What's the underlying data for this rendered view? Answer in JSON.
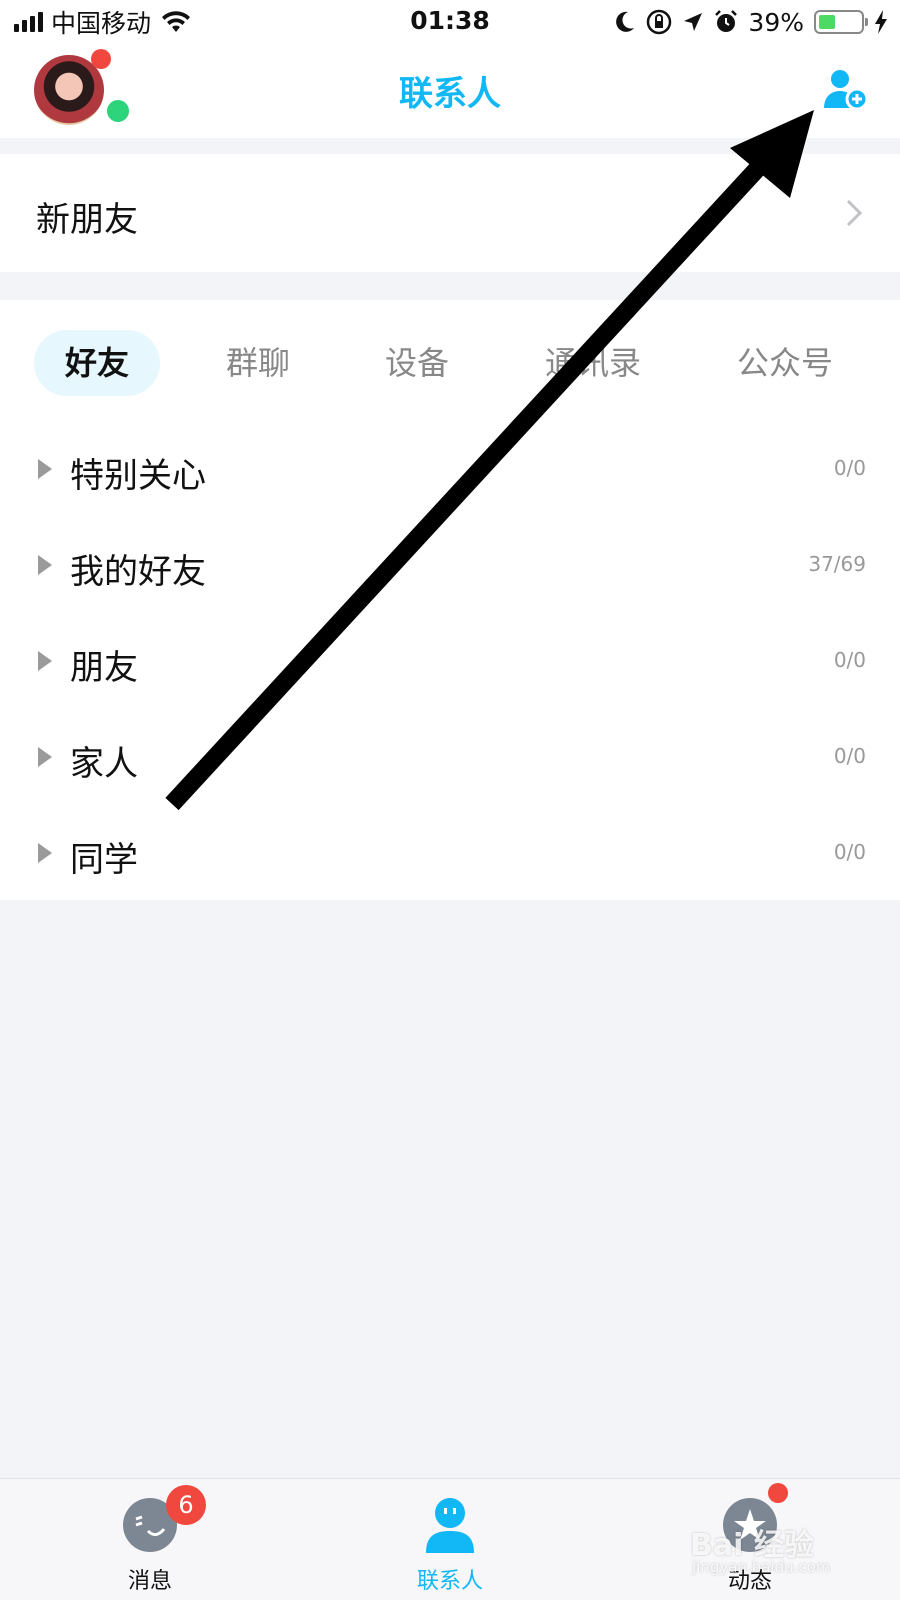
{
  "status_bar": {
    "carrier": "中国移动",
    "time": "01:38",
    "battery_percent": "39%",
    "battery_level": 0.39,
    "icons": [
      "signal-icon",
      "wifi-icon",
      "moon-icon",
      "orientation-lock-icon",
      "location-icon",
      "alarm-icon",
      "battery-icon",
      "charging-icon"
    ]
  },
  "header": {
    "title": "联系人",
    "avatar_icon": "user-avatar",
    "add_icon": "add-friend-icon"
  },
  "new_friends": {
    "label": "新朋友"
  },
  "tabs": [
    {
      "label": "好友",
      "active": true
    },
    {
      "label": "群聊",
      "active": false
    },
    {
      "label": "设备",
      "active": false
    },
    {
      "label": "通讯录",
      "active": false
    },
    {
      "label": "公众号",
      "active": false
    }
  ],
  "groups": [
    {
      "name": "特别关心",
      "count": "0/0"
    },
    {
      "name": "我的好友",
      "count": "37/69"
    },
    {
      "name": "朋友",
      "count": "0/0"
    },
    {
      "name": "家人",
      "count": "0/0"
    },
    {
      "name": "同学",
      "count": "0/0"
    }
  ],
  "tab_bar": {
    "items": [
      {
        "label": "消息",
        "badge": "6",
        "icon": "messages-icon"
      },
      {
        "label": "联系人",
        "icon": "contacts-icon",
        "active": true
      },
      {
        "label": "动态",
        "icon": "feed-icon"
      }
    ]
  },
  "watermark": {
    "text": "Bai 经验",
    "sub": "jingyan.baidu.com"
  },
  "colors": {
    "accent": "#12b7f5",
    "badge": "#f0483e",
    "online": "#2dd47b",
    "background": "#f3f4f8"
  }
}
